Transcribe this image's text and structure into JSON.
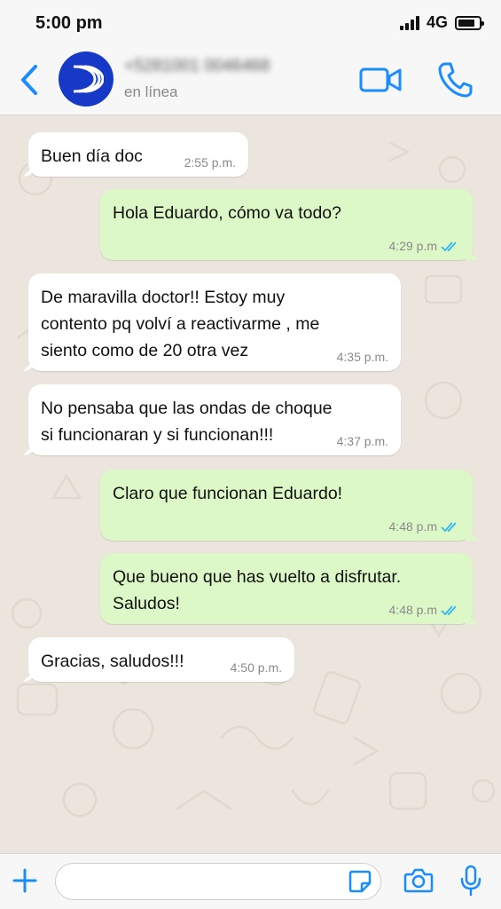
{
  "status_bar": {
    "time": "5:00 pm",
    "network": "4G"
  },
  "header": {
    "contact_name": "+5281001 0046468",
    "contact_status": "en línea",
    "back_icon": "chevron-left-icon",
    "video_icon": "video-camera-icon",
    "call_icon": "phone-icon"
  },
  "messages": [
    {
      "direction": "in",
      "lines": [
        "Buen día doc"
      ],
      "time": "2:55 p.m."
    },
    {
      "direction": "out",
      "lines": [
        "Hola Eduardo, cómo va todo?"
      ],
      "time": "4:29 p.m"
    },
    {
      "direction": "in",
      "lines": [
        "De maravilla doctor!! Estoy muy",
        "contento pq volví a reactivarme , me",
        "siento como de 20 otra vez"
      ],
      "time": "4:35 p.m."
    },
    {
      "direction": "in",
      "lines": [
        "No pensaba que las ondas de choque",
        "si funcionaran y si funcionan!!!"
      ],
      "time": "4:37 p.m."
    },
    {
      "direction": "out",
      "lines": [
        "Claro que funcionan Eduardo!"
      ],
      "time": "4:48 p.m"
    },
    {
      "direction": "out",
      "lines": [
        "Que bueno que has vuelto a disfrutar.",
        "Saludos!"
      ],
      "time": "4:48 p.m"
    },
    {
      "direction": "in",
      "lines": [
        "Gracias, saludos!!!"
      ],
      "time": "4:50 p.m."
    }
  ],
  "composer": {
    "placeholder": "",
    "value": ""
  },
  "colors": {
    "accent": "#1a8cff",
    "incoming": "#ffffff",
    "outgoing": "#dcf8c6",
    "read_ticks": "#34b7f1",
    "avatar": "#1639c8"
  }
}
